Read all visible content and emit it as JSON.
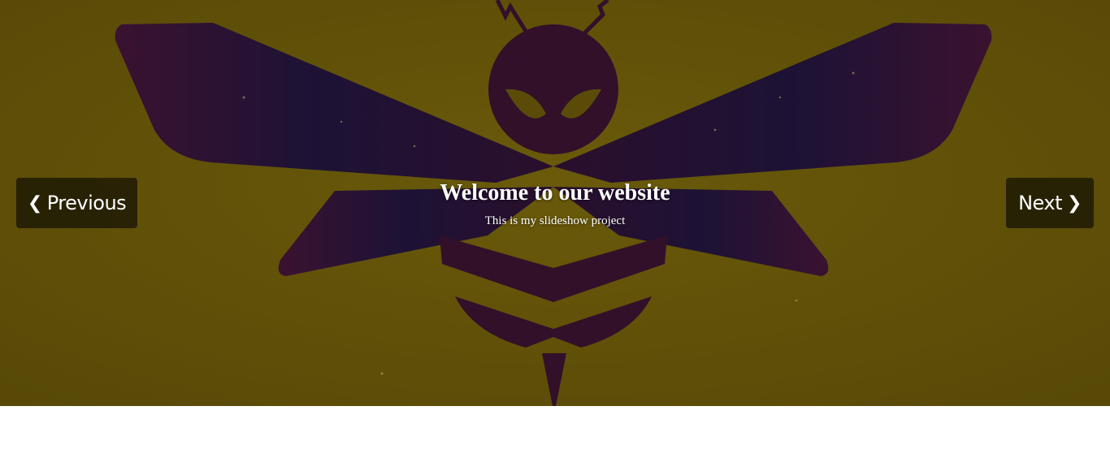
{
  "slide": {
    "title": "Welcome to our website",
    "subtitle": "This is my slideshow project",
    "image_description_icon": "bee-emblem-icon"
  },
  "navigation": {
    "previous_label": "Previous",
    "previous_icon": "❮",
    "next_label": "Next",
    "next_icon": "❯"
  },
  "colors": {
    "background": "#5e5008",
    "emblem": "#35102a",
    "button_bg": "#1a1504",
    "text": "#ffffff"
  }
}
